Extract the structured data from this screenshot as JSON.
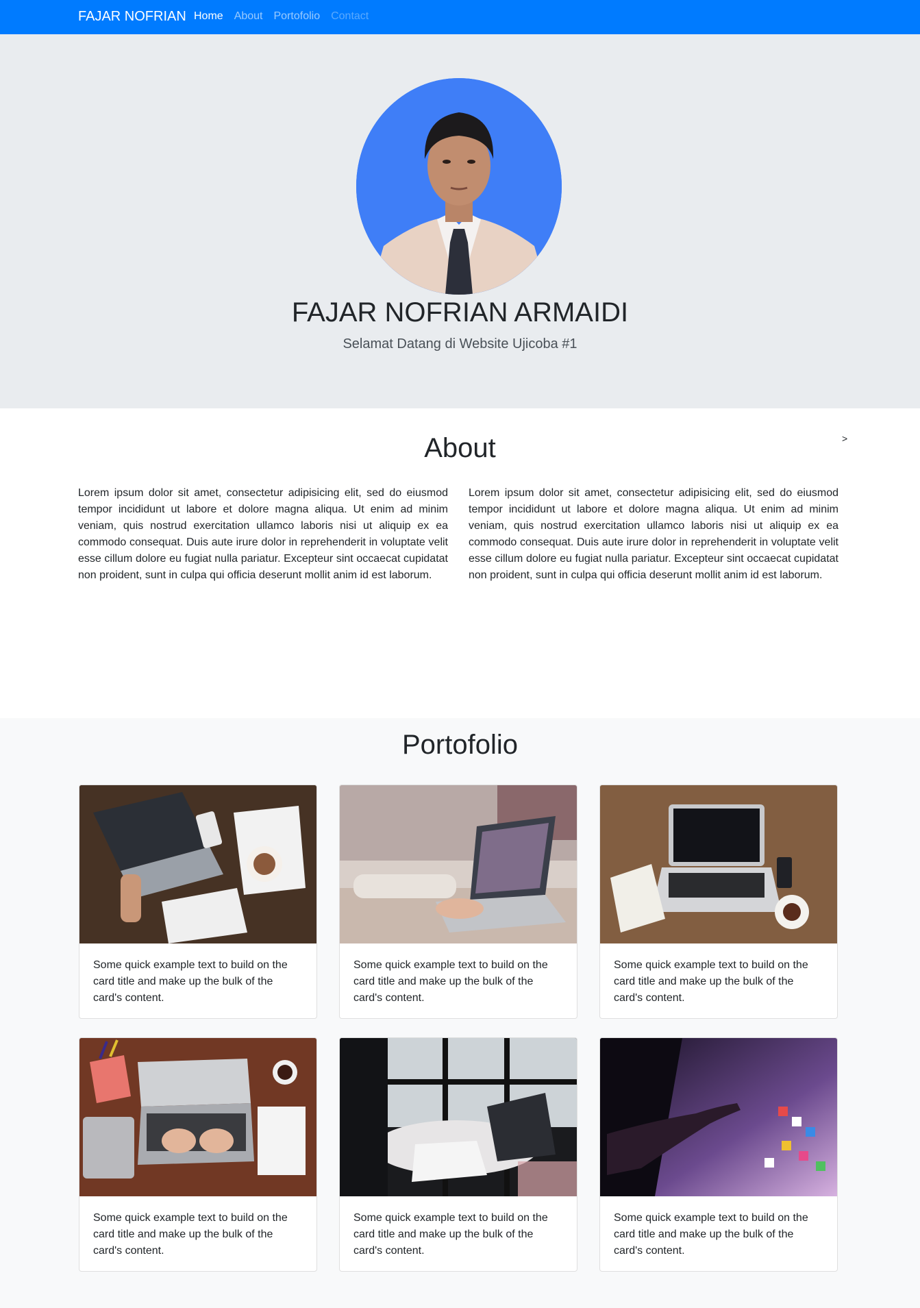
{
  "navbar": {
    "brand": "FAJAR NOFRIAN",
    "links": [
      "Home",
      "About",
      "Portofolio",
      "Contact"
    ]
  },
  "hero": {
    "name": "FAJAR NOFRIAN ARMAIDI",
    "subtitle": "Selamat Datang di Website Ujicoba #1"
  },
  "about": {
    "title": "About",
    "stray_text": ">",
    "paragraphs": [
      "Lorem ipsum dolor sit amet, consectetur adipisicing elit, sed do eiusmod tempor incididunt ut labore et dolore magna aliqua. Ut enim ad minim veniam, quis nostrud exercitation ullamco laboris nisi ut aliquip ex ea commodo consequat. Duis aute irure dolor in reprehenderit in voluptate velit esse cillum dolore eu fugiat nulla pariatur. Excepteur sint occaecat cupidatat non proident, sunt in culpa qui officia deserunt mollit anim id est laborum.",
      "Lorem ipsum dolor sit amet, consectetur adipisicing elit, sed do eiusmod tempor incididunt ut labore et dolore magna aliqua. Ut enim ad minim veniam, quis nostrud exercitation ullamco laboris nisi ut aliquip ex ea commodo consequat. Duis aute irure dolor in reprehenderit in voluptate velit esse cillum dolore eu fugiat nulla pariatur. Excepteur sint occaecat cupidatat non proident, sunt in culpa qui officia deserunt mollit anim id est laborum."
    ]
  },
  "portfolio": {
    "title": "Portofolio",
    "cards": [
      {
        "text": "Some quick example text to build on the card title and make up the bulk of the card's content."
      },
      {
        "text": "Some quick example text to build on the card title and make up the bulk of the card's content."
      },
      {
        "text": "Some quick example text to build on the card title and make up the bulk of the card's content."
      },
      {
        "text": "Some quick example text to build on the card title and make up the bulk of the card's content."
      },
      {
        "text": "Some quick example text to build on the card title and make up the bulk of the card's content."
      },
      {
        "text": "Some quick example text to build on the card title and make up the bulk of the card's content."
      }
    ]
  },
  "colors": {
    "navbar": "#007bff",
    "hero_bg": "#e9ecef",
    "portfolio_bg": "#f8f9fa",
    "avatar_bg": "#3f7ef7"
  }
}
